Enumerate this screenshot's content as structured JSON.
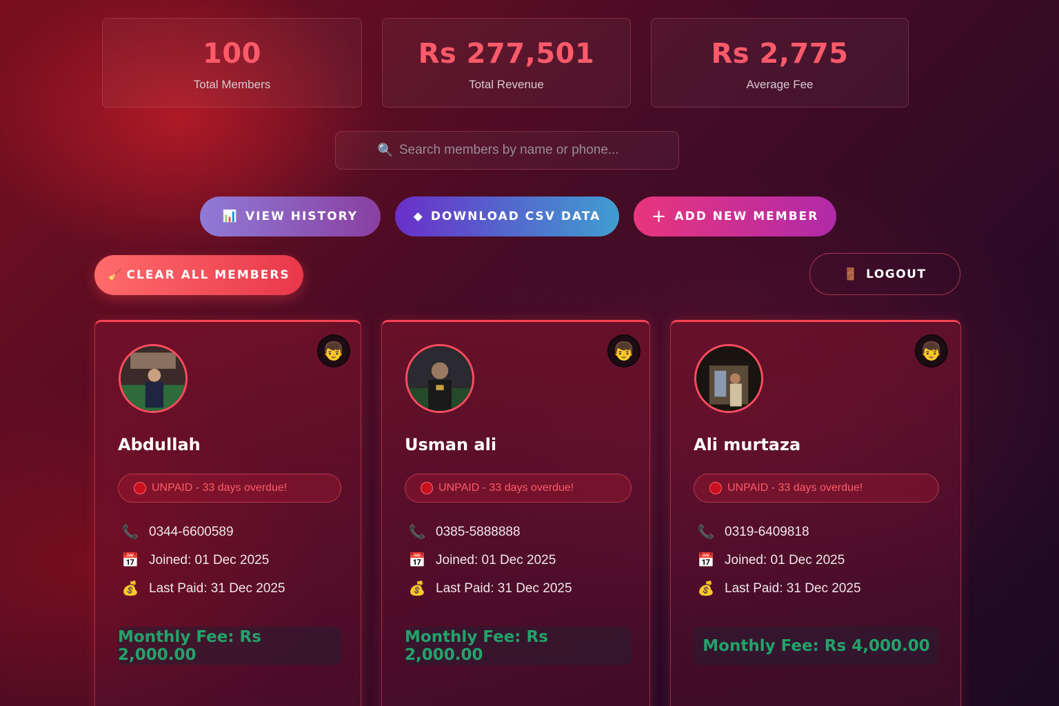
{
  "stats": [
    {
      "value": "100",
      "label": "Total Members"
    },
    {
      "value": "Rs 277,501",
      "label": "Total Revenue"
    },
    {
      "value": "Rs 2,775",
      "label": "Average Fee"
    }
  ],
  "search": {
    "icon": "🔍",
    "placeholder": "Search members by name or phone..."
  },
  "actions": {
    "history": {
      "icon": "📊",
      "label": "VIEW HISTORY"
    },
    "csv": {
      "icon": "◆",
      "label": "DOWNLOAD CSV DATA"
    },
    "add": {
      "icon": "+",
      "label": "ADD NEW MEMBER"
    },
    "clear": {
      "icon": "🧹",
      "label": "CLEAR ALL MEMBERS"
    },
    "logout": {
      "icon": "🚪",
      "label": "LOGOUT"
    }
  },
  "icons": {
    "gender": "👦",
    "phone": "📞",
    "calendar": "📅",
    "money": "💰"
  },
  "members": [
    {
      "name": "Abdullah",
      "status": "UNPAID - 33 days overdue!",
      "phone": "0344-6600589",
      "joined": "Joined: 01 Dec 2025",
      "last_paid": "Last Paid: 31 Dec 2025",
      "fee": "Monthly Fee: Rs 2,000.00"
    },
    {
      "name": "Usman ali",
      "status": "UNPAID - 33 days overdue!",
      "phone": "0385-5888888",
      "joined": "Joined: 01 Dec 2025",
      "last_paid": "Last Paid: 31 Dec 2025",
      "fee": "Monthly Fee: Rs 2,000.00"
    },
    {
      "name": "Ali murtaza",
      "status": "UNPAID - 33 days overdue!",
      "phone": "0319-6409818",
      "joined": "Joined: 01 Dec 2025",
      "last_paid": "Last Paid: 31 Dec 2025",
      "fee": "Monthly Fee: Rs 4,000.00"
    }
  ],
  "colors": {
    "accent": "#ff5a6a",
    "fee": "#22a36b",
    "unpaid": "#c8101e"
  }
}
